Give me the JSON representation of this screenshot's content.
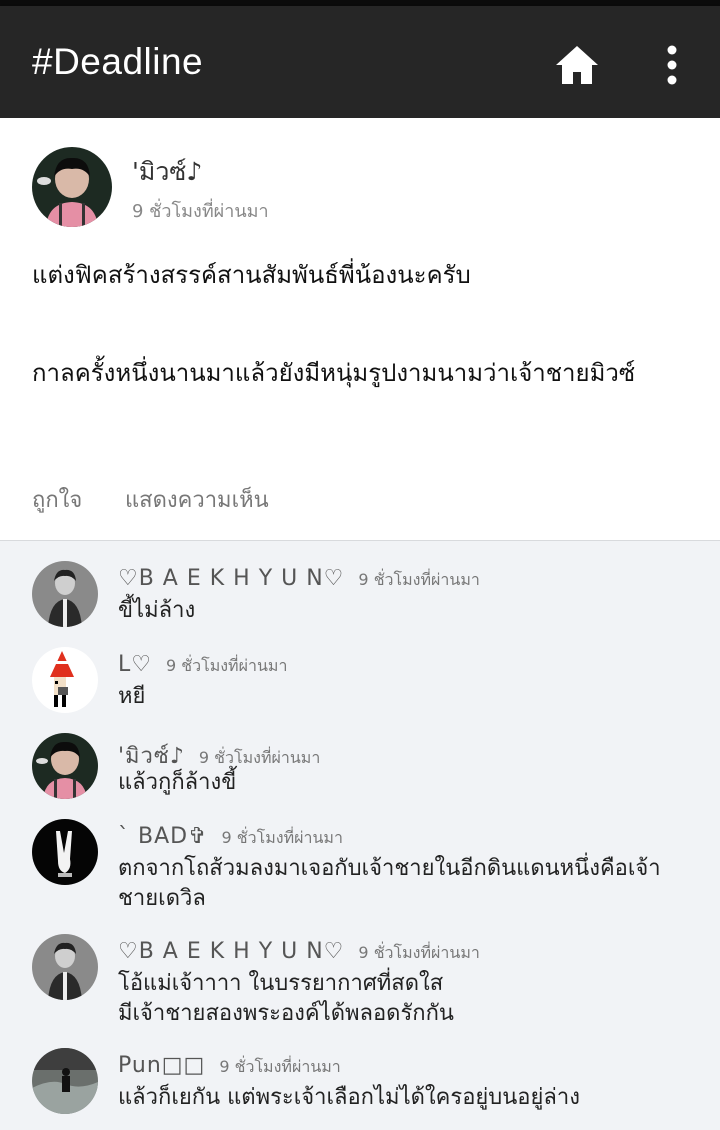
{
  "app": {
    "title": "#Deadline"
  },
  "post": {
    "author": "'มิวซ์♪",
    "time": "9 ชั่วโมงที่ผ่านมา",
    "line1": "แต่งฟิคสร้างสรรค์สานสัมพันธ์พี่น้องนะครับ",
    "line2": "กาลครั้งหนึ่งนานมาแล้วยังมีหนุ่มรูปงามนามว่าเจ้าชายมิวซ์",
    "like_label": "ถูกใจ",
    "comment_label": "แสดงความเห็น"
  },
  "comments": [
    {
      "name": "♡B A E K H Y U N♡",
      "time": "9 ชั่วโมงที่ผ่านมา",
      "text": "ขี้ไม่ล้าง"
    },
    {
      "name": "L♡",
      "time": "9 ชั่วโมงที่ผ่านมา",
      "text": "หยี"
    },
    {
      "name": "'มิวซ์♪",
      "time": "9 ชั่วโมงที่ผ่านมา",
      "text": "แล้วกูก็ล้างขี้"
    },
    {
      "name": "` BAD✞",
      "time": "9 ชั่วโมงที่ผ่านมา",
      "text": "ตกจากโถส้วมลงมาเจอกับเจ้าชายในอีกดินแดนหนึ่งคือเจ้าชายเดวิล"
    },
    {
      "name": "♡B A E K H Y U N♡",
      "time": "9 ชั่วโมงที่ผ่านมา",
      "text_line1": "โอ้แม่เจ้าาาา ในบรรยากาศที่สดใส",
      "text_line2": "มีเจ้าชายสองพระองค์ได้พลอดรักกัน"
    },
    {
      "name": "Pun□□",
      "time": "9 ชั่วโมงที่ผ่านมา",
      "text": "แล้วก็เยกัน แต่พระเจ้าเลือกไม่ได้ใครอยู่บนอยู่ล่าง"
    }
  ]
}
